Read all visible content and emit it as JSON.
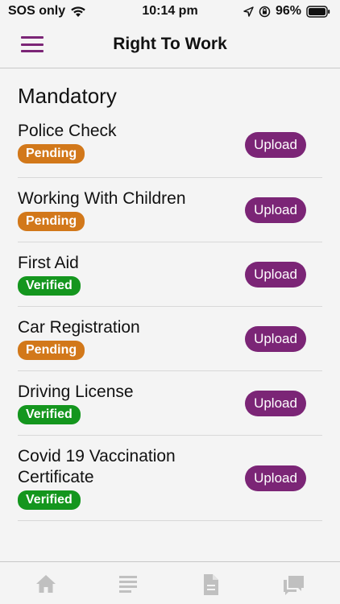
{
  "status_bar": {
    "carrier": "SOS only",
    "time": "10:14 pm",
    "battery": "96%"
  },
  "header": {
    "title": "Right To Work"
  },
  "section": {
    "title": "Mandatory"
  },
  "documents": [
    {
      "name": "Police Check",
      "status": "Pending",
      "action": "Upload"
    },
    {
      "name": "Working With Children",
      "status": "Pending",
      "action": "Upload"
    },
    {
      "name": "First Aid",
      "status": "Verified",
      "action": "Upload"
    },
    {
      "name": "Car Registration",
      "status": "Pending",
      "action": "Upload"
    },
    {
      "name": "Driving License",
      "status": "Verified",
      "action": "Upload"
    },
    {
      "name": "Covid 19 Vaccination Certificate",
      "status": "Verified",
      "action": "Upload"
    }
  ],
  "colors": {
    "accent": "#7b2576",
    "pending": "#d2781a",
    "verified": "#14961e",
    "tab_icon": "#c0c0c0"
  },
  "tabs": [
    {
      "icon": "home-icon"
    },
    {
      "icon": "list-icon"
    },
    {
      "icon": "document-icon"
    },
    {
      "icon": "chat-icon"
    }
  ]
}
